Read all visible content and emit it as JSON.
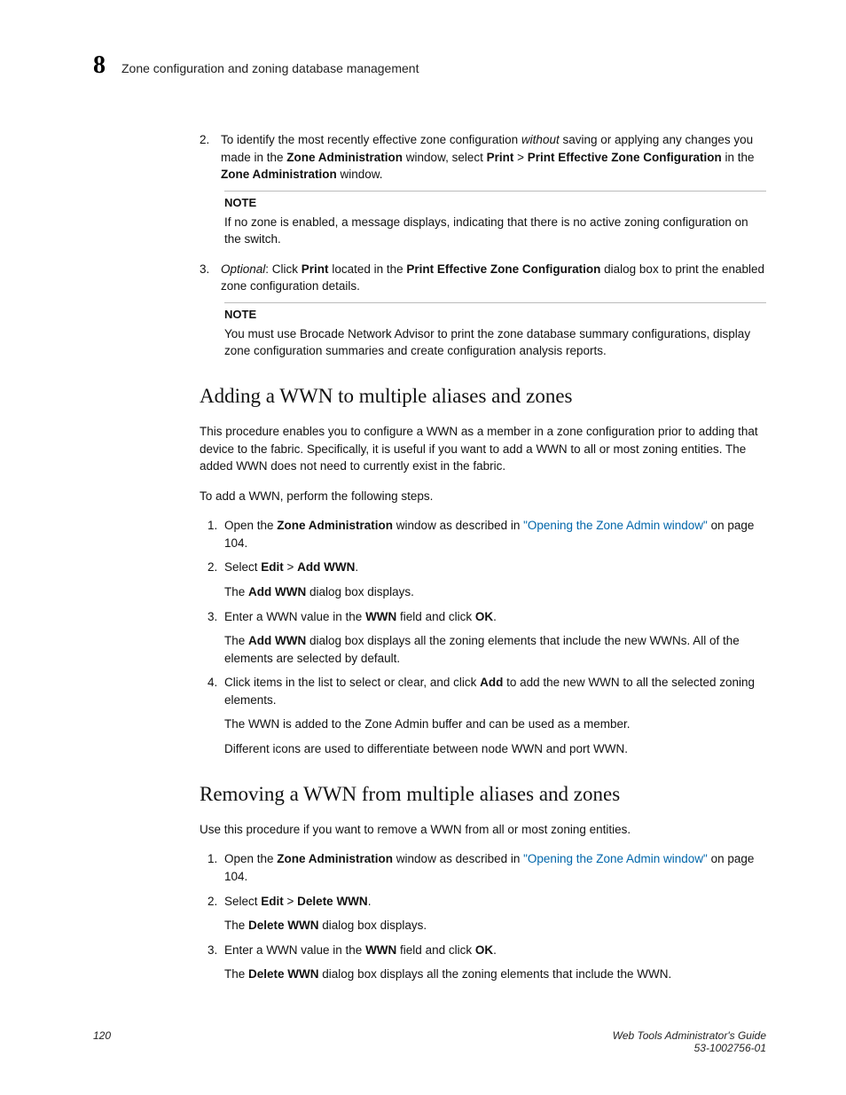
{
  "header": {
    "chapter_number": "8",
    "section_title": "Zone configuration and zoning database management"
  },
  "top_steps": [
    {
      "num": "2.",
      "runs": [
        {
          "t": "To identify the most recently effective zone configuration "
        },
        {
          "t": "without",
          "i": true
        },
        {
          "t": " saving or applying any changes you made in the "
        },
        {
          "t": "Zone Administration",
          "b": true
        },
        {
          "t": " window, select "
        },
        {
          "t": "Print",
          "b": true
        },
        {
          "t": " > "
        },
        {
          "t": "Print Effective Zone Configuration",
          "b": true
        },
        {
          "t": " in the "
        },
        {
          "t": "Zone Administration",
          "b": true
        },
        {
          "t": " window."
        }
      ],
      "note": {
        "head": "NOTE",
        "body": "If no zone is enabled, a message displays, indicating that there is no active zoning configuration on the switch."
      }
    },
    {
      "num": "3.",
      "runs": [
        {
          "t": "Optional",
          "i": true
        },
        {
          "t": ": Click "
        },
        {
          "t": "Print",
          "b": true
        },
        {
          "t": " located in the "
        },
        {
          "t": "Print Effective Zone Configuration",
          "b": true
        },
        {
          "t": " dialog box to print the enabled zone configuration details."
        }
      ],
      "note": {
        "head": "NOTE",
        "body": "You must use Brocade Network Advisor to print the zone database summary configurations, display zone configuration summaries and create configuration analysis reports."
      }
    }
  ],
  "adding": {
    "title": "Adding a WWN to multiple aliases and zones",
    "intro": "This procedure enables you to configure a WWN as a member in a zone configuration prior to adding that device to the fabric. Specifically, it is useful if you want to add a WWN to all or most zoning entities. The added WWN does not need to currently exist in the fabric.",
    "intro2": "To add a WWN, perform the following steps.",
    "steps": [
      {
        "runs": [
          {
            "t": "Open the "
          },
          {
            "t": "Zone Administration",
            "b": true
          },
          {
            "t": " window as described in "
          },
          {
            "t": "\"Opening the Zone Admin window\"",
            "link": true
          },
          {
            "t": " on page 104."
          }
        ]
      },
      {
        "runs": [
          {
            "t": "Select "
          },
          {
            "t": "Edit",
            "b": true
          },
          {
            "t": " > "
          },
          {
            "t": "Add WWN",
            "b": true
          },
          {
            "t": "."
          }
        ],
        "after": [
          {
            "runs": [
              {
                "t": "The "
              },
              {
                "t": "Add WWN",
                "b": true
              },
              {
                "t": " dialog box displays."
              }
            ]
          }
        ]
      },
      {
        "runs": [
          {
            "t": "Enter a WWN value in the "
          },
          {
            "t": "WWN",
            "b": true
          },
          {
            "t": " field and click "
          },
          {
            "t": "OK",
            "b": true
          },
          {
            "t": "."
          }
        ],
        "after": [
          {
            "runs": [
              {
                "t": "The "
              },
              {
                "t": "Add WWN",
                "b": true
              },
              {
                "t": " dialog box displays all the zoning elements that include the new WWNs. All of the elements are selected by default."
              }
            ]
          }
        ]
      },
      {
        "runs": [
          {
            "t": "Click items in the list to select or clear, and click "
          },
          {
            "t": "Add",
            "b": true
          },
          {
            "t": " to add the new WWN to all the selected zoning elements."
          }
        ],
        "after": [
          {
            "runs": [
              {
                "t": "The WWN is added to the Zone Admin buffer and can be used as a member."
              }
            ]
          },
          {
            "runs": [
              {
                "t": "Different icons are used to differentiate between node WWN and port WWN."
              }
            ]
          }
        ]
      }
    ]
  },
  "removing": {
    "title": "Removing a WWN from multiple aliases and zones",
    "intro": "Use this procedure if you want to remove a WWN from all or most zoning entities.",
    "steps": [
      {
        "runs": [
          {
            "t": "Open the "
          },
          {
            "t": "Zone Administration",
            "b": true
          },
          {
            "t": " window as described in "
          },
          {
            "t": "\"Opening the Zone Admin window\"",
            "link": true
          },
          {
            "t": " on page 104."
          }
        ]
      },
      {
        "runs": [
          {
            "t": "Select "
          },
          {
            "t": "Edit",
            "b": true
          },
          {
            "t": " > "
          },
          {
            "t": "Delete WWN",
            "b": true
          },
          {
            "t": "."
          }
        ],
        "after": [
          {
            "runs": [
              {
                "t": "The "
              },
              {
                "t": "Delete WWN",
                "b": true
              },
              {
                "t": " dialog box displays."
              }
            ]
          }
        ]
      },
      {
        "runs": [
          {
            "t": "Enter a WWN value in the "
          },
          {
            "t": "WWN",
            "b": true
          },
          {
            "t": " field and click "
          },
          {
            "t": "OK",
            "b": true
          },
          {
            "t": "."
          }
        ],
        "after": [
          {
            "runs": [
              {
                "t": "The "
              },
              {
                "t": "Delete WWN",
                "b": true
              },
              {
                "t": " dialog box displays all the zoning elements that include the WWN."
              }
            ]
          }
        ]
      }
    ]
  },
  "footer": {
    "page": "120",
    "book": "Web Tools Administrator's Guide",
    "docnum": "53-1002756-01"
  }
}
